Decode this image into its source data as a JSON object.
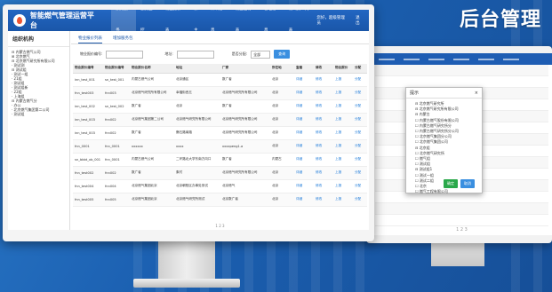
{
  "corner_title": "后台管理",
  "app": {
    "title": "智能燃气管理运营平台",
    "nav": [
      "预约服务",
      "服务监控",
      "物业报价表",
      "系主",
      "详细信息",
      "物业运行表",
      "管理信息",
      "燃气员工列表"
    ],
    "user": [
      "您好，超级管理员",
      "退出"
    ]
  },
  "sidebar": {
    "title": "组织机构",
    "items": [
      "⊟ 内蒙古燃气公司",
      "⊞ 北京燃气",
      "⊟ 北京燃气研究所有限公司",
      "· 测试测",
      "⊟ 测试组",
      "· 测试一组",
      "· 21组",
      "· 测试组",
      "· 测试组新",
      "· 22组",
      "· 上海组",
      "⊟ 内蒙古燃气分",
      "· 办公",
      "· 北京燃气集团第二公司",
      "· 测试组"
    ]
  },
  "tabs": [
    "物业报价列表",
    "增加服务包"
  ],
  "filters": {
    "label1": "物业报价编号:",
    "label2": "地址:",
    "label3": "是否分配:",
    "select": "全部",
    "button": "查询"
  },
  "table": {
    "headers": [
      "物业报价编号",
      "物业报价编号",
      "物业报价名称",
      "地址",
      "厂家",
      "所在地",
      "查看",
      "修改",
      "物业报价",
      "分配"
    ],
    "rows": [
      [
        "inn_test_001",
        "sn_test_001",
        "内蒙古燃气公司",
        "北京通区",
        "数广者",
        "北京",
        "详细",
        "修改",
        "上报",
        "分配"
      ],
      [
        "fnn_test003",
        "fnn003",
        "北京燃气研究所有限公司",
        "幸福街西五",
        "北京燃气研究所有限公司",
        "北京",
        "详细",
        "修改",
        "上报",
        "分配"
      ],
      [
        "inn_test_002",
        "sn_test_002",
        "数广者",
        "北京",
        "数广者",
        "北京",
        "详细",
        "修改",
        "上报",
        "分配"
      ],
      [
        "inn_test_003",
        "fnn002",
        "北京燃气集团第二公司",
        "北京燃气研究所有限公司",
        "北京燃气研究所有限公司",
        "北京",
        "详细",
        "修改",
        "上报",
        "分配"
      ],
      [
        "inn_test_003",
        "fnn002",
        "数广者",
        "磐石路南路",
        "北京燃气研究所有限公司",
        "北京",
        "详细",
        "修改",
        "上报",
        "分配"
      ],
      [
        "fnn_0001",
        "fnn_0001",
        "xxxxxx",
        "xxxx",
        "xxxxpeng1.a",
        "北京",
        "详细",
        "修改",
        "上报",
        "分配"
      ],
      [
        "sn_bbbt_xb_001",
        "fnn_0001",
        "内蒙古燃气公司",
        "二环路北大学东南方向口",
        "数广者",
        "内蒙古",
        "详细",
        "修改",
        "上报",
        "分配"
      ],
      [
        "fnn_test002",
        "fnn002",
        "数广者",
        "象村",
        "北京燃气研究所有限公司",
        "北京",
        "详细",
        "修改",
        "上报",
        "分配"
      ],
      [
        "fnn_test004",
        "fnn004",
        "北京燃气集团北京",
        "北京朝阳区办事处测试",
        "北京燃气",
        "北京",
        "详细",
        "修改",
        "上报",
        "分配"
      ],
      [
        "fnn_test005",
        "fnn005",
        "北京燃气集团北京",
        "北京燃气研究所测试",
        "北京数广者",
        "北京",
        "详细",
        "修改",
        "上报",
        "分配"
      ]
    ]
  },
  "pager": "1 2 3",
  "dialog": {
    "title": "提示",
    "items": [
      "⊟ 北京燃气研究所",
      "⊟ 北京燃气研究所有限公司",
      "⊟ 内蒙古",
      "☐ 内蒙古燃气股份有限公司",
      "☐ 内蒙古燃气研究所分",
      "☐ 内蒙古燃气研究所分公司",
      "☐ 北京燃气集团分公司",
      "☐ 北京燃气集团公司",
      "⊟ 北京组",
      "☐ 北京燃气研究所",
      "☐ 燃气组",
      "☐ 测试组",
      "⊟ 测试组1",
      "☐ 测试一组",
      "☐ 测试二组",
      "☐ 北京",
      "☐ 燃气工程有限公司"
    ],
    "ok": "确定",
    "cancel": "取消"
  },
  "back_pager": "1 2 3",
  "colors": {
    "brand": "#1a56a8",
    "accent": "#3a8fe0",
    "ok": "#2aa84a",
    "cancel": "#3a8fe0"
  }
}
